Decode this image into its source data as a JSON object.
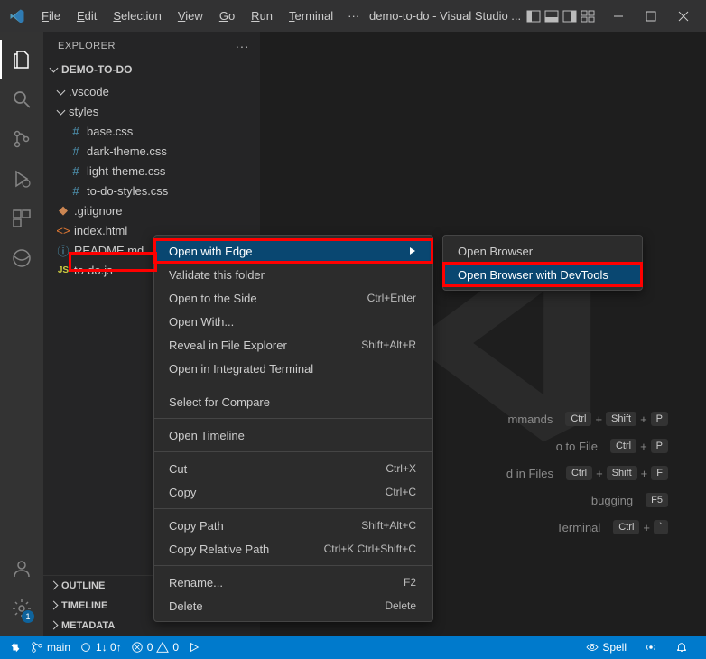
{
  "title_bar": {
    "menus": [
      "File",
      "Edit",
      "Selection",
      "View",
      "Go",
      "Run",
      "Terminal"
    ],
    "overflow": "···",
    "title": "demo-to-do - Visual Studio ..."
  },
  "explorer": {
    "header": "EXPLORER",
    "dots": "···",
    "root": "DEMO-TO-DO",
    "folders": {
      "vscode": ".vscode",
      "styles": "styles"
    },
    "files": {
      "base": "base.css",
      "dark": "dark-theme.css",
      "light": "light-theme.css",
      "todo_styles": "to-do-styles.css",
      "gitignore": ".gitignore",
      "index": "index.html",
      "readme": "README.md",
      "todojs": "to-do.js"
    },
    "bottom": {
      "outline": "OUTLINE",
      "timeline": "TIMELINE",
      "metadata": "METADATA"
    }
  },
  "context_menu": {
    "open_edge": "Open with Edge",
    "validate": "Validate this folder",
    "open_side": {
      "label": "Open to the Side",
      "shortcut": "Ctrl+Enter"
    },
    "open_with": "Open With...",
    "reveal": {
      "label": "Reveal in File Explorer",
      "shortcut": "Shift+Alt+R"
    },
    "integrated": "Open in Integrated Terminal",
    "select_compare": "Select for Compare",
    "open_timeline": "Open Timeline",
    "cut": {
      "label": "Cut",
      "shortcut": "Ctrl+X"
    },
    "copy": {
      "label": "Copy",
      "shortcut": "Ctrl+C"
    },
    "copy_path": {
      "label": "Copy Path",
      "shortcut": "Shift+Alt+C"
    },
    "copy_rel": {
      "label": "Copy Relative Path",
      "shortcut": "Ctrl+K Ctrl+Shift+C"
    },
    "rename": {
      "label": "Rename...",
      "shortcut": "F2"
    },
    "delete": {
      "label": "Delete",
      "shortcut": "Delete"
    }
  },
  "submenu": {
    "open_browser": "Open Browser",
    "open_devtools": "Open Browser with DevTools"
  },
  "hints": [
    {
      "label": "mmands",
      "keys": [
        "Ctrl",
        "Shift",
        "P"
      ]
    },
    {
      "label": "o to File",
      "keys": [
        "Ctrl",
        "P"
      ]
    },
    {
      "label": "d in Files",
      "keys": [
        "Ctrl",
        "Shift",
        "F"
      ]
    },
    {
      "label": "bugging",
      "keys": [
        "F5"
      ]
    },
    {
      "label": "Terminal",
      "keys": [
        "Ctrl",
        "`"
      ]
    }
  ],
  "status_bar": {
    "icons": {
      "remote": "⚡"
    },
    "branch": "main",
    "sync": "1↓ 0↑",
    "errors": "0",
    "warnings": "0",
    "spell": "Spell",
    "settings_badge": "1"
  }
}
